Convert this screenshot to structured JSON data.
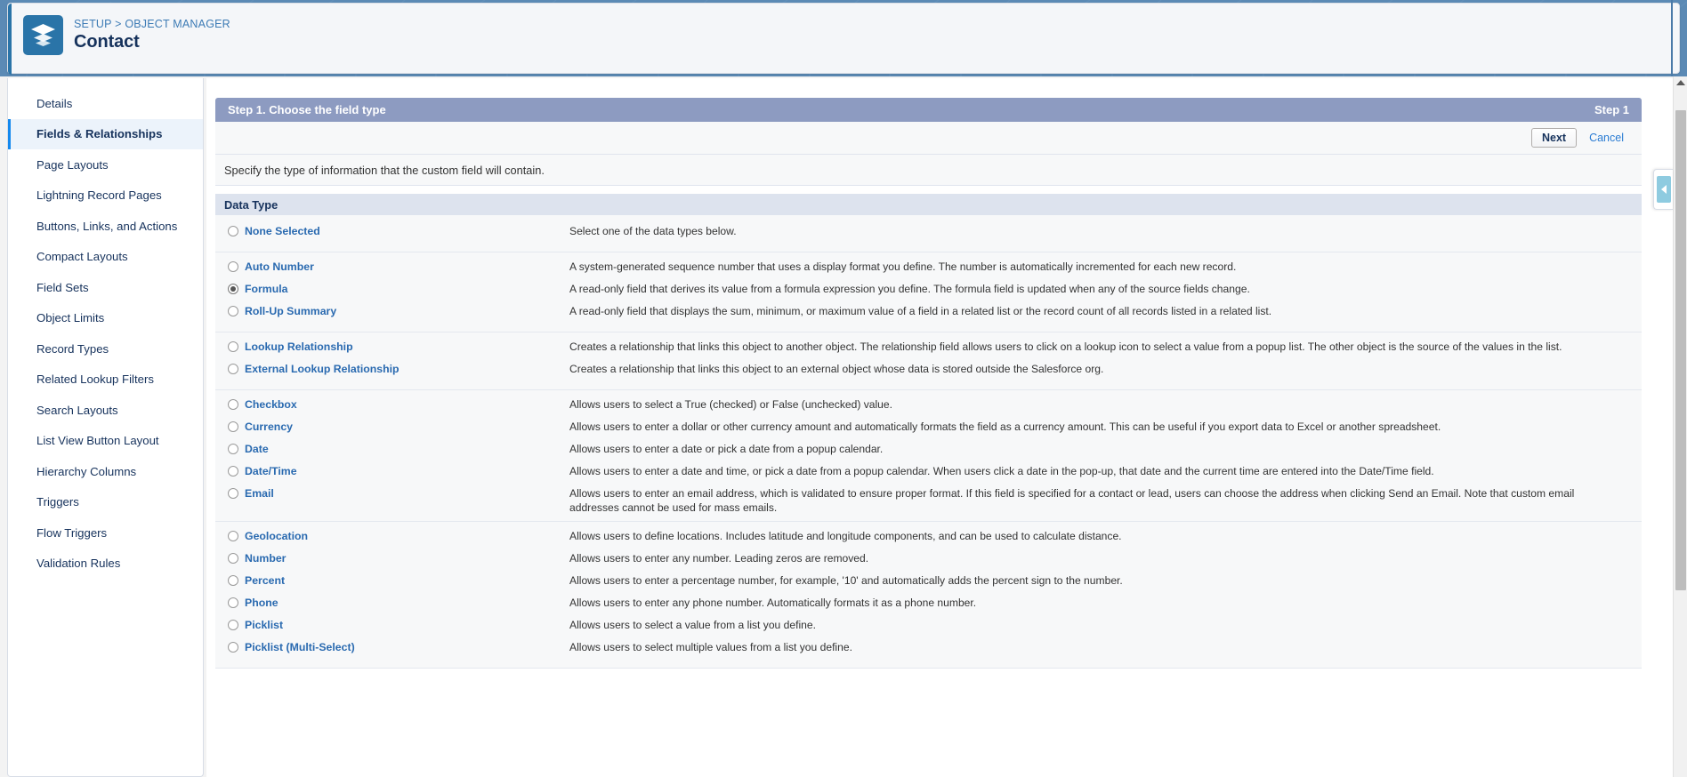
{
  "header": {
    "breadcrumb_setup": "SETUP",
    "breadcrumb_separator": ">",
    "breadcrumb_object_manager": "OBJECT MANAGER",
    "page_title": "Contact",
    "object_icon": "layers-icon",
    "accent_color": "#2a74a8"
  },
  "sidebar": {
    "items": [
      {
        "label": "Details",
        "active": false
      },
      {
        "label": "Fields & Relationships",
        "active": true
      },
      {
        "label": "Page Layouts",
        "active": false
      },
      {
        "label": "Lightning Record Pages",
        "active": false
      },
      {
        "label": "Buttons, Links, and Actions",
        "active": false
      },
      {
        "label": "Compact Layouts",
        "active": false
      },
      {
        "label": "Field Sets",
        "active": false
      },
      {
        "label": "Object Limits",
        "active": false
      },
      {
        "label": "Record Types",
        "active": false
      },
      {
        "label": "Related Lookup Filters",
        "active": false
      },
      {
        "label": "Search Layouts",
        "active": false
      },
      {
        "label": "List View Button Layout",
        "active": false
      },
      {
        "label": "Hierarchy Columns",
        "active": false
      },
      {
        "label": "Triggers",
        "active": false
      },
      {
        "label": "Flow Triggers",
        "active": false
      },
      {
        "label": "Validation Rules",
        "active": false
      }
    ]
  },
  "wizard": {
    "step_title": "Step 1. Choose the field type",
    "step_number": "Step 1",
    "next_label": "Next",
    "cancel_label": "Cancel",
    "instruction": "Specify the type of information that the custom field will contain.",
    "section_header": "Data Type",
    "header_bg": "#8d9bc1",
    "section_bg": "#dde3ee"
  },
  "data_types": {
    "groups": [
      {
        "rows": [
          {
            "label": "None Selected",
            "selected": false,
            "description": "Select one of the data types below."
          }
        ]
      },
      {
        "rows": [
          {
            "label": "Auto Number",
            "selected": false,
            "description": "A system-generated sequence number that uses a display format you define. The number is automatically incremented for each new record."
          },
          {
            "label": "Formula",
            "selected": true,
            "description": "A read-only field that derives its value from a formula expression you define. The formula field is updated when any of the source fields change."
          },
          {
            "label": "Roll-Up Summary",
            "selected": false,
            "description": "A read-only field that displays the sum, minimum, or maximum value of a field in a related list or the record count of all records listed in a related list."
          }
        ]
      },
      {
        "rows": [
          {
            "label": "Lookup Relationship",
            "selected": false,
            "description": "Creates a relationship that links this object to another object. The relationship field allows users to click on a lookup icon to select a value from a popup list. The other object is the source of the values in the list."
          },
          {
            "label": "External Lookup Relationship",
            "selected": false,
            "description": "Creates a relationship that links this object to an external object whose data is stored outside the Salesforce org."
          }
        ]
      },
      {
        "rows": [
          {
            "label": "Checkbox",
            "selected": false,
            "description": "Allows users to select a True (checked) or False (unchecked) value."
          },
          {
            "label": "Currency",
            "selected": false,
            "description": "Allows users to enter a dollar or other currency amount and automatically formats the field as a currency amount. This can be useful if you export data to Excel or another spreadsheet."
          },
          {
            "label": "Date",
            "selected": false,
            "description": "Allows users to enter a date or pick a date from a popup calendar."
          },
          {
            "label": "Date/Time",
            "selected": false,
            "description": "Allows users to enter a date and time, or pick a date from a popup calendar. When users click a date in the pop-up, that date and the current time are entered into the Date/Time field."
          },
          {
            "label": "Email",
            "selected": false,
            "description": "Allows users to enter an email address, which is validated to ensure proper format. If this field is specified for a contact or lead, users can choose the address when clicking Send an Email. Note that custom email addresses cannot be used for mass emails."
          }
        ]
      },
      {
        "rows": [
          {
            "label": "Geolocation",
            "selected": false,
            "description": "Allows users to define locations. Includes latitude and longitude components, and can be used to calculate distance."
          },
          {
            "label": "Number",
            "selected": false,
            "description": "Allows users to enter any number. Leading zeros are removed."
          },
          {
            "label": "Percent",
            "selected": false,
            "description": "Allows users to enter a percentage number, for example, '10' and automatically adds the percent sign to the number."
          },
          {
            "label": "Phone",
            "selected": false,
            "description": "Allows users to enter any phone number. Automatically formats it as a phone number."
          },
          {
            "label": "Picklist",
            "selected": false,
            "description": "Allows users to select a value from a list you define."
          },
          {
            "label": "Picklist (Multi-Select)",
            "selected": false,
            "description": "Allows users to select multiple values from a list you define."
          }
        ]
      }
    ]
  },
  "scrollbar": {
    "up_arrow_icon": "triangle-up-icon",
    "thumb": "vertical-scroll-thumb"
  },
  "panel_toggle": {
    "icon": "chevron-left-icon"
  }
}
